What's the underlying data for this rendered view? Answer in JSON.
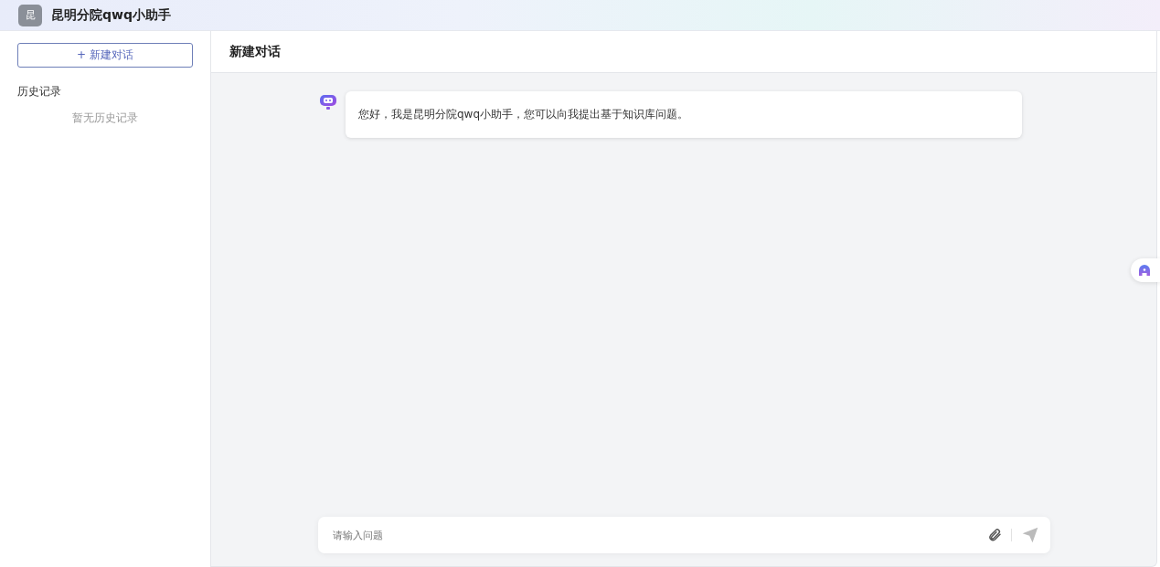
{
  "header": {
    "logo_letter": "昆",
    "title": "昆明分院qwq小助手"
  },
  "sidebar": {
    "new_chat_button": "+ 新建对话",
    "history_heading": "历史记录",
    "history_empty": "暂无历史记录"
  },
  "chat": {
    "title": "新建对话",
    "messages": [
      {
        "kind": "bot",
        "text": "您好，我是昆明分院qwq小助手，您可以向我提出基于知识库问题。"
      }
    ],
    "input": {
      "placeholder": "请输入问题"
    }
  }
}
